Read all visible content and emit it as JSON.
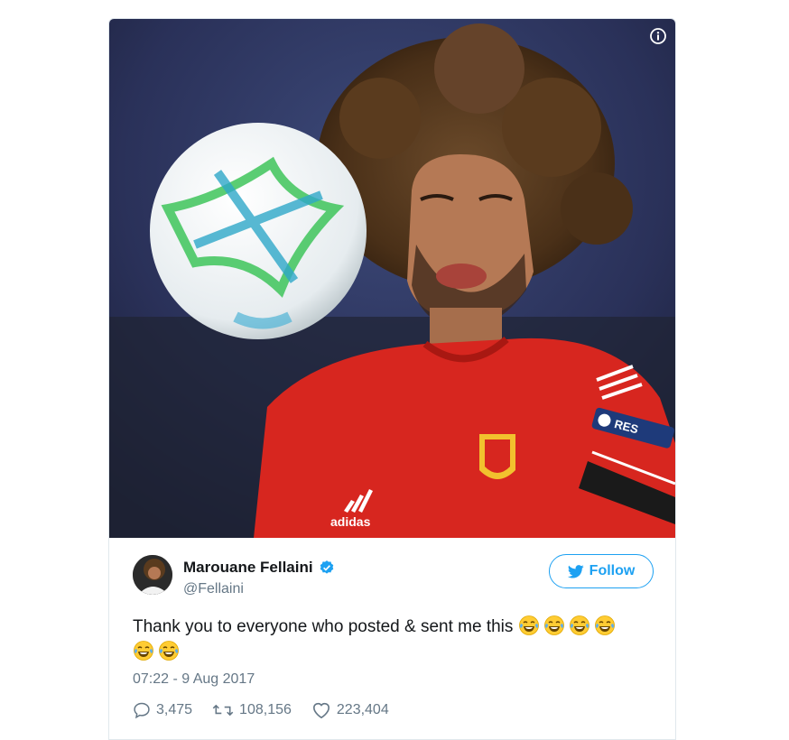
{
  "media": {
    "alt": "",
    "badge": "RES"
  },
  "author": {
    "display_name": "Marouane Fellaini",
    "handle": "@Fellaini",
    "verified": true
  },
  "follow_button": {
    "label": "Follow"
  },
  "tweet": {
    "text_line1": "Thank you to everyone who posted & sent me this",
    "emoji_count": 6,
    "emoji_icon": "face-with-tears-of-joy",
    "timestamp": "07:22 - 9 Aug 2017"
  },
  "stats": {
    "replies": "3,475",
    "retweets": "108,156",
    "likes": "223,404"
  },
  "colors": {
    "accent": "#1da1f2",
    "muted": "#657786",
    "jersey": "#d7261f"
  }
}
